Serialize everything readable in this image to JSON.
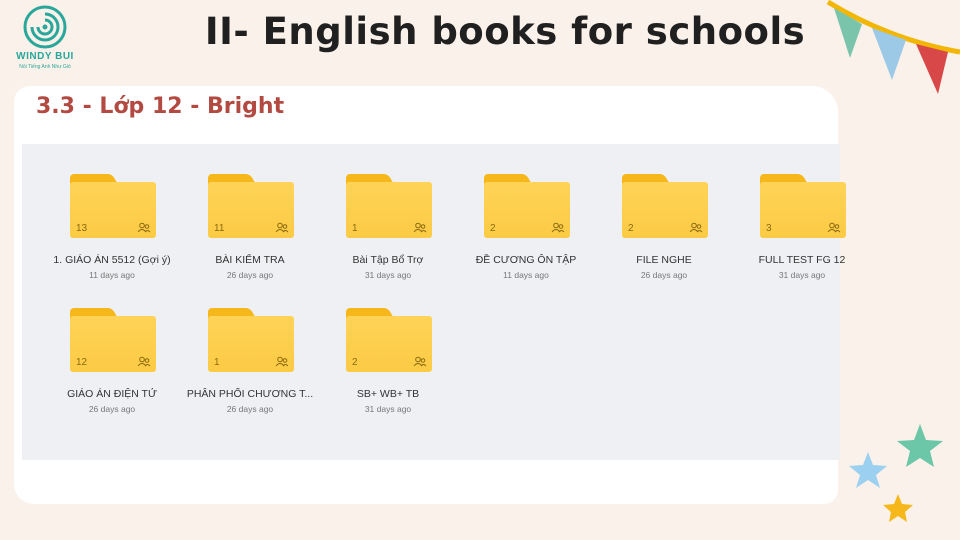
{
  "brand": {
    "name": "WINDY BUI",
    "tagline": "Nói Tiếng Anh Như Gió"
  },
  "header": {
    "title": "II- English books for schools",
    "subtitle": "3.3 - Lớp 12 - Bright"
  },
  "colors": {
    "folder": "#fccb45",
    "folder_tab": "#f6b71a",
    "title": "#202020",
    "subtitle": "#b24a41",
    "brand": "#2aa79b"
  },
  "folders": [
    {
      "name": "1. GIÁO ÁN 5512 (Gợi ý)",
      "count": "13",
      "modified": "11 days ago",
      "icon": "shared-icon"
    },
    {
      "name": "BÀI KIỂM TRA",
      "count": "11",
      "modified": "26 days ago",
      "icon": "shared-icon"
    },
    {
      "name": "Bài Tập Bổ Trợ",
      "count": "1",
      "modified": "31 days ago",
      "icon": "shared-icon"
    },
    {
      "name": "ĐỀ CƯƠNG ÔN TẬP",
      "count": "2",
      "modified": "11 days ago",
      "icon": "shared-icon"
    },
    {
      "name": "FILE NGHE",
      "count": "2",
      "modified": "26 days ago",
      "icon": "shared-icon"
    },
    {
      "name": "FULL TEST FG 12",
      "count": "3",
      "modified": "31 days ago",
      "icon": "shared-icon"
    },
    {
      "name": "GIÁO ÁN ĐIỆN TỬ",
      "count": "12",
      "modified": "26 days ago",
      "icon": "shared-icon"
    },
    {
      "name": "PHÂN PHỐI CHƯƠNG T...",
      "count": "1",
      "modified": "26 days ago",
      "icon": "shared-icon"
    },
    {
      "name": "SB+ WB+ TB",
      "count": "2",
      "modified": "31 days ago",
      "icon": "shared-icon"
    }
  ]
}
